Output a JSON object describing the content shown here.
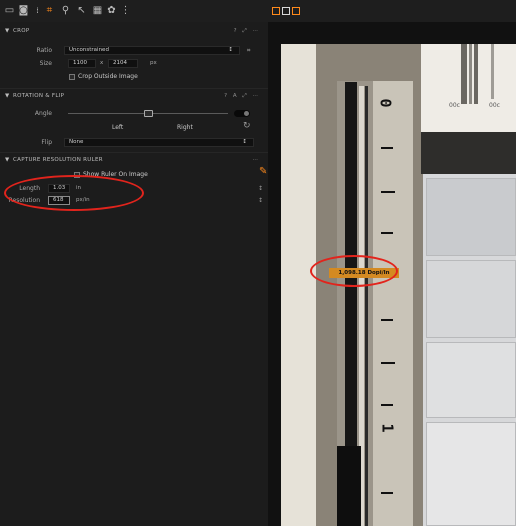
{
  "toolbar": {
    "icons": [
      "folder-icon",
      "camera-icon",
      "info-icon",
      "crop-icon",
      "zoom-icon",
      "pick-icon",
      "grid-icon",
      "settings-icon",
      "rotate-icon"
    ],
    "view_icons": [
      "grid-view-icon",
      "single-view-icon",
      "multi-view-icon"
    ]
  },
  "crop": {
    "title": "CROP",
    "ratio_label": "Ratio",
    "ratio_value": "Unconstrained",
    "size_label": "Size",
    "size_w": "1100",
    "size_x": "x",
    "size_h": "2104",
    "size_unit": "px",
    "crop_outside_label": "Crop Outside Image"
  },
  "rotation": {
    "title": "ROTATION & FLIP",
    "angle_label": "Angle",
    "angle_value": 0.5,
    "left_label": "Left",
    "right_label": "Right",
    "flip_label": "Flip",
    "flip_value": "None"
  },
  "capture": {
    "title": "CAPTURE RESOLUTION RULER",
    "show_ruler_label": "Show Ruler On Image",
    "length_label": "Length",
    "length_value": "1.03",
    "length_unit": "in",
    "resolution_label": "Resolution",
    "resolution_value": "618",
    "resolution_unit": "px/in"
  },
  "viewer": {
    "measurement": "1,098.18 Dopi/In",
    "ruler_numbers": [
      "0",
      "1"
    ],
    "top_labels": [
      "00c",
      "00c"
    ]
  },
  "colors": {
    "accent": "#ff8a1c",
    "highlight": "#e2241c"
  }
}
